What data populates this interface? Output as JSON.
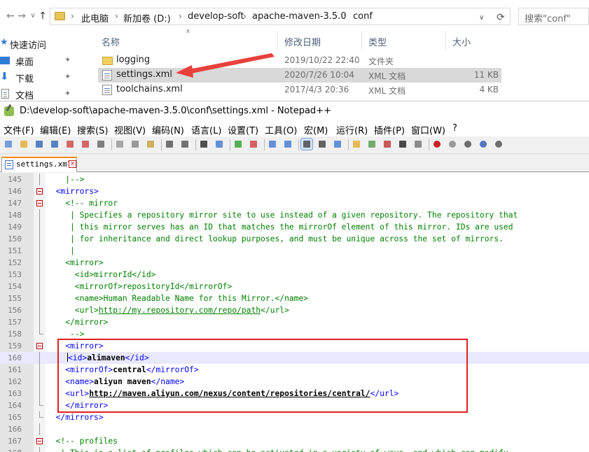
{
  "explorer": {
    "nav": {
      "back": "←",
      "forward": "→",
      "dropdown": "∨",
      "up": "↑"
    },
    "breadcrumb": [
      "此电脑",
      "新加卷 (D:)",
      "develop-soft",
      "apache-maven-3.5.0",
      "conf"
    ],
    "breadcrumb_sep": "›",
    "search_placeholder": "搜索\"conf\"",
    "sidebar": [
      {
        "label": "快速访问",
        "icon": "star-icon",
        "color": "#2f7bd6"
      },
      {
        "label": "桌面",
        "icon": "desktop-icon",
        "color": "#2f7bd6",
        "pinned": true
      },
      {
        "label": "下载",
        "icon": "download-icon",
        "color": "#2f7bd6",
        "pinned": true
      },
      {
        "label": "文档",
        "icon": "document-icon",
        "color": "#6d6d6d",
        "pinned": true
      }
    ],
    "pin_glyph": "📌",
    "columns": {
      "name": "名称",
      "modified": "修改日期",
      "type": "类型",
      "size": "大小"
    },
    "files": [
      {
        "name": "logging",
        "modified": "2019/10/22 22:40",
        "type": "文件夹",
        "size": "",
        "icon": "folder-icon"
      },
      {
        "name": "settings.xml",
        "modified": "2020/7/26 10:04",
        "type": "XML 文档",
        "size": "11 KB",
        "icon": "xml-file-icon",
        "selected": true
      },
      {
        "name": "toolchains.xml",
        "modified": "2017/4/3 20:36",
        "type": "XML 文档",
        "size": "4 KB",
        "icon": "xml-file-icon"
      }
    ]
  },
  "notepad": {
    "title": "D:\\develop-soft\\apache-maven-3.5.0\\conf\\settings.xml - Notepad++",
    "menu": [
      "文件(F)",
      "编辑(E)",
      "搜索(S)",
      "视图(V)",
      "编码(N)",
      "语言(L)",
      "设置(T)",
      "工具(O)",
      "宏(M)",
      "运行(R)",
      "插件(P)",
      "窗口(W)",
      "?"
    ],
    "tab_label": "settings.xml",
    "tab_close": "x",
    "accent_color": "#fa8c00",
    "highlight_color": "#e02020",
    "toolbar_icons": [
      "new-file-icon",
      "open-file-icon",
      "save-icon",
      "save-all-icon",
      "close-icon",
      "close-all-icon",
      "print-icon",
      "cut-icon",
      "copy-icon",
      "paste-icon",
      "undo-icon",
      "redo-icon",
      "find-icon",
      "replace-icon",
      "zoom-in-icon",
      "zoom-out-icon",
      "sync-vertical-icon",
      "sync-horizontal-icon",
      "word-wrap-icon",
      "show-all-chars-icon",
      "indent-guide-icon",
      "user-language-icon",
      "doc-map-icon",
      "function-list-icon",
      "folder-workspace-icon",
      "monitoring-icon",
      "record-macro-icon",
      "stop-record-icon",
      "play-macro-icon",
      "run-macro-multiple-icon",
      "save-macro-icon"
    ],
    "lines": [
      {
        "n": "145",
        "text": "    |-->"
      },
      {
        "n": "146",
        "text": "  <mirrors>"
      },
      {
        "n": "147",
        "text": "    <!-- mirror"
      },
      {
        "n": "148",
        "text": "     | Specifies a repository mirror site to use instead of a given repository. The repository that"
      },
      {
        "n": "149",
        "text": "     | this mirror serves has an ID that matches the mirrorOf element of this mirror. IDs are used"
      },
      {
        "n": "150",
        "text": "     | for inheritance and direct lookup purposes, and must be unique across the set of mirrors."
      },
      {
        "n": "151",
        "text": "     |"
      },
      {
        "n": "152",
        "text": "    <mirror>"
      },
      {
        "n": "153",
        "text": "      <id>mirrorId</id>"
      },
      {
        "n": "154",
        "text": "      <mirrorOf>repositoryId</mirrorOf>"
      },
      {
        "n": "155",
        "text": "      <name>Human Readable Name for this Mirror.</name>"
      },
      {
        "n": "156",
        "text": "      <url>http://my.repository.com/repo/path</url>"
      },
      {
        "n": "157",
        "text": "    </mirror>"
      },
      {
        "n": "158",
        "text": "     -->"
      },
      {
        "n": "159",
        "text": "    <mirror>"
      },
      {
        "n": "160",
        "text": "<id>alimaven</id>"
      },
      {
        "n": "161",
        "text": "    <mirrorOf>central</mirrorOf>"
      },
      {
        "n": "162",
        "text": "    <name>aliyun maven</name>"
      },
      {
        "n": "163",
        "text": "    <url>http://maven.aliyun.com/nexus/content/repositories/central/</url>"
      },
      {
        "n": "164",
        "text": "    </mirror>"
      },
      {
        "n": "165",
        "text": "  </mirrors>"
      },
      {
        "n": "166",
        "text": ""
      },
      {
        "n": "167",
        "text": "  <!-- profiles"
      },
      {
        "n": "168",
        "text": "   | This is a list of profiles which can be activated in a variety of ways, and which can modify"
      }
    ]
  }
}
